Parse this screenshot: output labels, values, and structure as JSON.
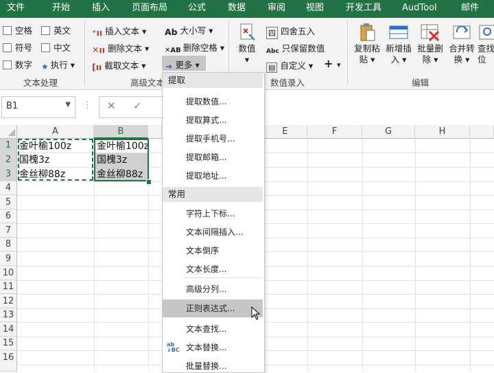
{
  "menubar": {
    "tabs": [
      "文件",
      "开始",
      "插入",
      "页面布局",
      "公式",
      "数据",
      "审阅",
      "视图",
      "开发工具",
      "AudTool",
      "邮件"
    ]
  },
  "ribbon": {
    "checkboxes": [
      "空格",
      "英文",
      "符号",
      "中文",
      "数字"
    ],
    "execute_label": "执行",
    "text_tools": [
      "插入文本",
      "删除文本",
      "截取文本"
    ],
    "case_tools": [
      "大小写",
      "删除空格",
      "更多"
    ],
    "number_button": "数值",
    "round_label": "四舍五入",
    "keep_numbers_label": "只保留数值",
    "custom_label": "自定义",
    "plus_label": "+",
    "edit_buttons": [
      {
        "line1": "复制粘",
        "line2": "贴"
      },
      {
        "line1": "新增插",
        "line2": "入"
      },
      {
        "line1": "批量删",
        "line2": "除"
      },
      {
        "line1": "合并转",
        "line2": "换"
      },
      {
        "line1": "查找",
        "line2": "位"
      }
    ],
    "groups": {
      "text_processing": "文本处理",
      "advanced_text": "高级文本",
      "number_entry": "数值录入",
      "edit": "编辑"
    }
  },
  "formula_bar": {
    "name_box": "B1",
    "cancel": "✕",
    "confirm": "✓",
    "dots": "⋮"
  },
  "sheet": {
    "columns": [
      "A",
      "B",
      "C",
      "D",
      "E",
      "F",
      "G",
      "H"
    ],
    "rows": [
      "1",
      "2",
      "3",
      "4",
      "5",
      "6",
      "7",
      "8",
      "9",
      "10",
      "11",
      "12",
      "13",
      "14",
      "15",
      "16"
    ],
    "col_a": [
      "金叶榆100z",
      "国槐3z",
      "金丝柳88z"
    ],
    "col_b": [
      "金叶榆100z",
      "国槐3z",
      "金丝柳88z"
    ]
  },
  "dropdown": {
    "section_extract": "提取",
    "extract_items": [
      "提取数值...",
      "提取算式...",
      "提取手机号...",
      "提取邮箱...",
      "提取地址..."
    ],
    "section_common": "常用",
    "common_items": [
      "字符上下标...",
      "文本间隔插入...",
      "文本倒序",
      "文本长度...",
      "高级分列...",
      "正则表达式...",
      "文本查找...",
      "文本替换...",
      "批量替换..."
    ]
  },
  "colors": {
    "accent": "#217346",
    "hover": "#c6c6c6",
    "selected_cell_fill": "#d0d0d0"
  }
}
